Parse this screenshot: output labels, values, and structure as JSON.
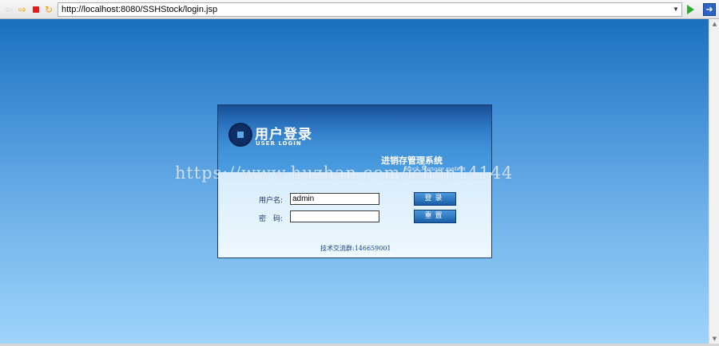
{
  "browser": {
    "url": "http://localhost:8080/SSHStock/login.jsp",
    "icons": {
      "back": "back-arrow-icon",
      "forward": "forward-arrow-icon",
      "stop": "stop-icon",
      "refresh": "refresh-icon",
      "dropdown": "chevron-down-icon",
      "go": "go-icon",
      "jump": "jump-icon"
    }
  },
  "login": {
    "title": "用户登录",
    "subtitle": "USER LOGIN",
    "system_title": "进销存管理系统",
    "system_subtitle": "Stock Manage system",
    "username_label": "用户名:",
    "username_value": "admin",
    "password_label": "密　码:",
    "password_value": "",
    "login_button": "登录",
    "reset_button": "重置",
    "support_text": "技术交流群:146659001"
  },
  "watermark": "https://www.huzhan.com/ishop14144",
  "colors": {
    "background_top": "#1a6fbe",
    "background_bottom": "#9fd4fb",
    "panel_header": "#2c75c1",
    "panel_body": "#e7f4fd",
    "button": "#1a5fa8"
  }
}
